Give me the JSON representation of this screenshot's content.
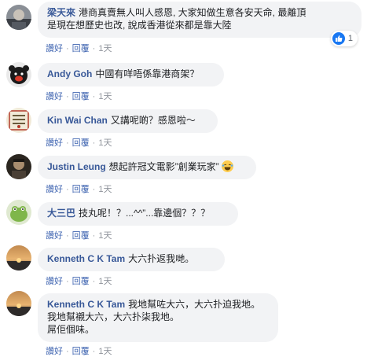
{
  "comments": [
    {
      "author": "梁天來",
      "text_lines": [
        "港商真賣無人叫人感恩, 大家知做生意各安天命, 最離頂",
        "是現在想歷史也改, 說成香港從來都是靠大陸"
      ],
      "actions": {
        "like": "讚好",
        "reply": "回覆",
        "time": "1天"
      },
      "reactions": {
        "count": "1",
        "icon": "like-icon"
      }
    },
    {
      "author": "Andy Goh",
      "text_lines": [
        "中國有咩唔係靠港商架？"
      ],
      "actions": {
        "like": "讚好",
        "reply": "回覆",
        "time": "1天"
      }
    },
    {
      "author": "Kin Wai Chan",
      "text_lines": [
        "又講呢啲？感恩啦～"
      ],
      "actions": {
        "like": "讚好",
        "reply": "回覆",
        "time": "1天"
      }
    },
    {
      "author": "Justin Leung",
      "text_lines": [
        "想起許冠文電影”創業玩家”"
      ],
      "emoji": "laughing-emoji",
      "actions": {
        "like": "讚好",
        "reply": "回覆",
        "time": "1天"
      }
    },
    {
      "author": "大三巴",
      "text_lines": [
        "技丸呢！？...^^”...靠邊個？？？"
      ],
      "actions": {
        "like": "讚好",
        "reply": "回覆",
        "time": "1天"
      }
    },
    {
      "author": "Kenneth C K Tam",
      "text_lines": [
        "大六扑返我哋。"
      ],
      "actions": {
        "like": "讚好",
        "reply": "回覆",
        "time": "1天"
      }
    },
    {
      "author": "Kenneth C K Tam",
      "text_lines": [
        "我地幫咗大六，大六扑迫我地。",
        "我地幫襯大六，大六扑柒我地。",
        "屌佢個味。"
      ],
      "actions": {
        "like": "讚好",
        "reply": "回覆",
        "time": "1天"
      }
    }
  ],
  "colors": {
    "author": "#385898",
    "bubble": "#f2f3f5",
    "link": "#4267b2",
    "like": "#1877f2"
  }
}
